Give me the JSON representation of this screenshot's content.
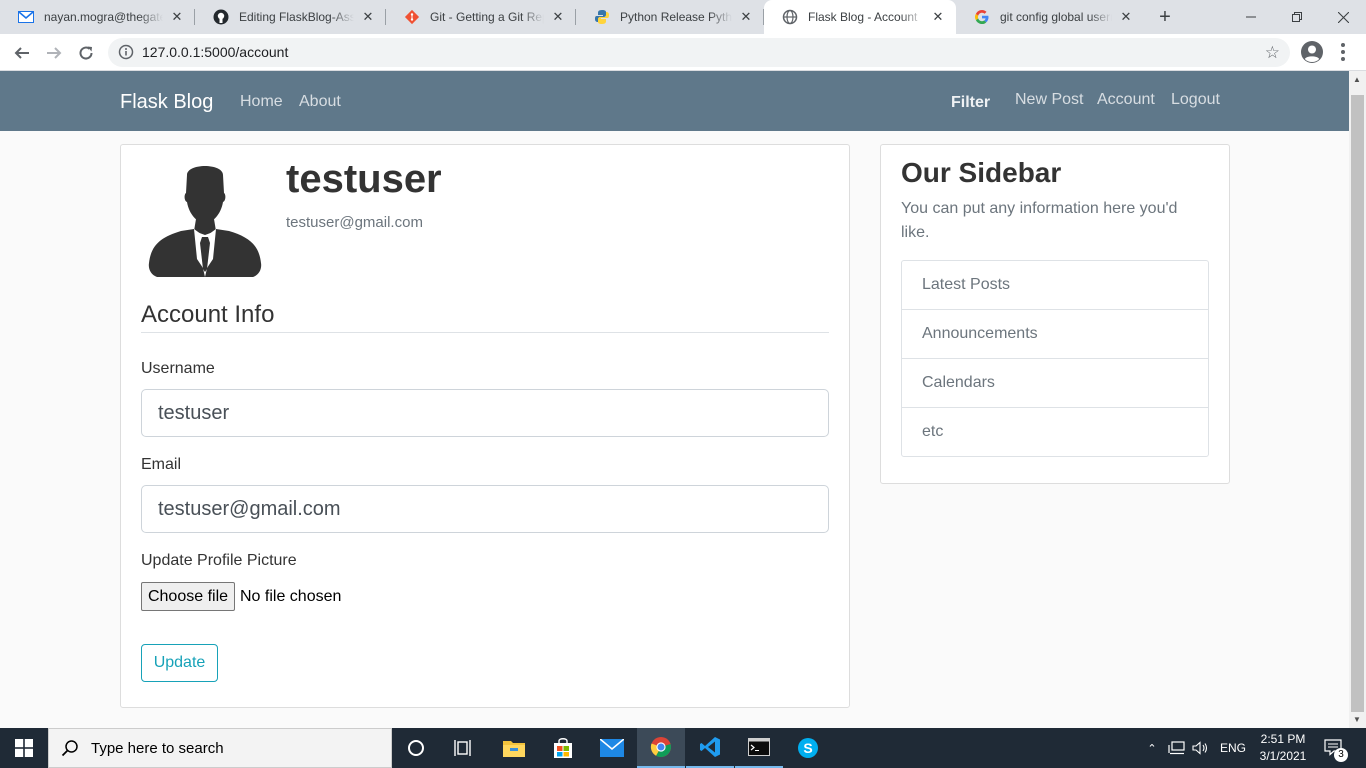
{
  "browser": {
    "tabs": [
      {
        "title": "nayan.mogra@thegate",
        "icon": "gmail-icon"
      },
      {
        "title": "Editing FlaskBlog-Assig",
        "icon": "github-icon"
      },
      {
        "title": "Git - Getting a Git Repo",
        "icon": "git-icon"
      },
      {
        "title": "Python Release Python",
        "icon": "python-icon"
      },
      {
        "title": "Flask Blog - Account",
        "icon": "globe-icon"
      },
      {
        "title": "git config global userna",
        "icon": "google-icon"
      }
    ],
    "url": "127.0.0.1:5000/account"
  },
  "navbar": {
    "brand": "Flask Blog",
    "left_links": [
      "Home",
      "About"
    ],
    "filter": "Filter",
    "right_links": [
      "New Post",
      "Account",
      "Logout"
    ]
  },
  "profile": {
    "username": "testuser",
    "email": "testuser@gmail.com"
  },
  "form": {
    "legend": "Account Info",
    "username_label": "Username",
    "username_value": "testuser",
    "email_label": "Email",
    "email_value": "testuser@gmail.com",
    "picture_label": "Update Profile Picture",
    "file_button": "Choose file",
    "file_status": "No file chosen",
    "submit": "Update"
  },
  "sidebar": {
    "title": "Our Sidebar",
    "text": "You can put any information here you'd like.",
    "items": [
      "Latest Posts",
      "Announcements",
      "Calendars",
      "etc"
    ]
  },
  "taskbar": {
    "search_placeholder": "Type here to search",
    "language": "ENG",
    "time": "2:51 PM",
    "date": "3/1/2021",
    "notifications": "3"
  },
  "colors": {
    "navbar": "#5f788a",
    "accent": "#17a2b8",
    "taskbar": "#1f2a36"
  }
}
